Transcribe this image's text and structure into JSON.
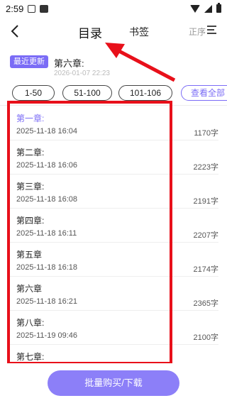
{
  "status_bar": {
    "time": "2:59"
  },
  "nav": {
    "title": "目录",
    "bookmark": "书签",
    "sort": "正序",
    "back_icon": "chevron-left-icon",
    "sort_icon": "sort-lines-icon"
  },
  "latest": {
    "badge": "最近更新",
    "title": "第六章:",
    "time": "2026-01-07 22:23"
  },
  "ranges": [
    "1-50",
    "51-100",
    "101-106"
  ],
  "view_all": "查看全部",
  "chapters": [
    {
      "title": "第一章:",
      "date": "2025-11-18 16:04",
      "words": "1170字",
      "active": true
    },
    {
      "title": "第二章:",
      "date": "2025-11-18 16:06",
      "words": "2223字"
    },
    {
      "title": "第三章:",
      "date": "2025-11-18 16:08",
      "words": "2191字"
    },
    {
      "title": "第四章:",
      "date": "2025-11-18 16:11",
      "words": "2207字"
    },
    {
      "title": "第五章",
      "date": "2025-11-18 16:18",
      "words": "2174字"
    },
    {
      "title": "第六章",
      "date": "2025-11-18 16:21",
      "words": "2365字"
    },
    {
      "title": "第八章:",
      "date": "2025-11-19 09:46",
      "words": "2100字"
    },
    {
      "title": "第七章:",
      "date": "",
      "words": ""
    }
  ],
  "bottom": {
    "bulk_label": "批量购买/下载"
  },
  "colors": {
    "accent": "#7b6cf6",
    "button": "#8c7ff8",
    "annotation": "#e8101a"
  }
}
